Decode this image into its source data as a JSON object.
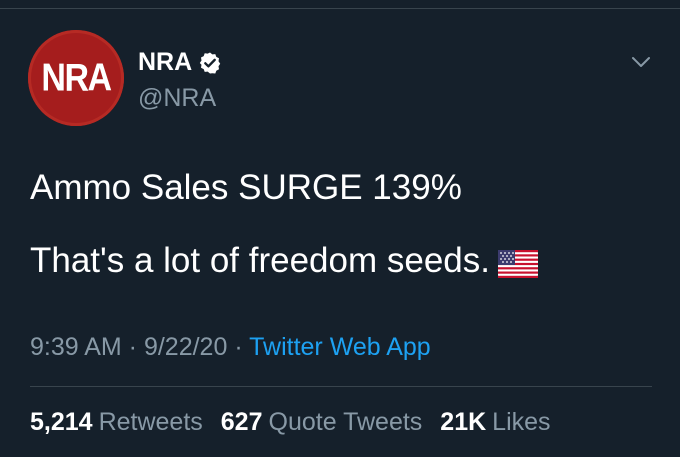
{
  "author": {
    "avatar_text": "NRA",
    "display_name": "NRA",
    "handle": "@NRA",
    "verified": true
  },
  "tweet": {
    "line1": "Ammo Sales SURGE 139%",
    "line2": "That's a lot of freedom seeds.",
    "emoji": "us-flag-icon"
  },
  "meta": {
    "time": "9:39 AM",
    "separator": " · ",
    "date": "9/22/20",
    "source": "Twitter Web App"
  },
  "stats": {
    "retweets_count": "5,214",
    "retweets_label": "Retweets",
    "quotes_count": "627",
    "quotes_label": "Quote Tweets",
    "likes_count": "21K",
    "likes_label": "Likes"
  },
  "colors": {
    "background": "#15202b",
    "text_primary": "#ffffff",
    "text_secondary": "#8899a6",
    "link": "#1da1f2",
    "avatar_bg": "#a51d1d"
  }
}
